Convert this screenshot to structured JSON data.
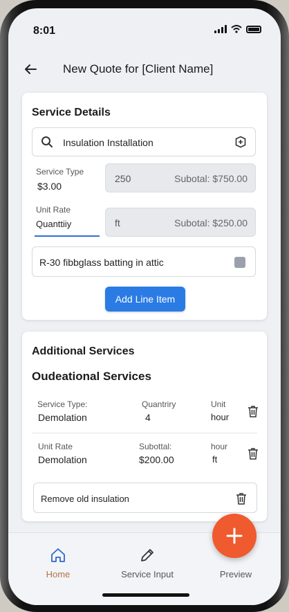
{
  "status": {
    "time": "8:01"
  },
  "header": {
    "title": "New Quote for [Client Name]",
    "back_icon": "arrow-left-icon"
  },
  "service_details": {
    "title": "Service Details",
    "search": {
      "value": "Insulation Installation",
      "icon": "search-icon",
      "action_icon": "add-box-icon"
    },
    "row1": {
      "label": "Service Type",
      "value": "$3.00",
      "field_value": "250",
      "subtotal": "Subotal: $750.00"
    },
    "row2": {
      "label": "Unit Rate",
      "value": "Quanttiiy",
      "field_value": "ft",
      "subtotal": "Subotal: $250.00"
    },
    "description": "R-30 fibbglass batting in attic",
    "add_button": "Add Line Item"
  },
  "additional": {
    "title": "Additional Services",
    "subtitle": "Oudeational Services",
    "row1": {
      "col1_label": "Service Type:",
      "col1_value": "Demolation",
      "col2_label": "Quantriry",
      "col2_value": "4",
      "col3_label": "Unit",
      "col3_value": "hour"
    },
    "row2": {
      "col1_label": "Unit Rate",
      "col1_value": "Demolation",
      "col2_label": "Subottal:",
      "col2_value": "$200.00",
      "col3_label": "hour",
      "col3_value": "ft"
    },
    "note": "Remove old insulation"
  },
  "nav": {
    "items": [
      {
        "label": "Home",
        "icon": "home-icon",
        "active": true
      },
      {
        "label": "Service Input",
        "icon": "pencil-icon",
        "active": false
      },
      {
        "label": "Preview",
        "icon": "preview-icon",
        "active": false
      }
    ],
    "fab_icon": "plus-icon"
  },
  "colors": {
    "accent": "#2a7be4",
    "fab": "#ef5a2e",
    "home_active": "#b5714a"
  }
}
